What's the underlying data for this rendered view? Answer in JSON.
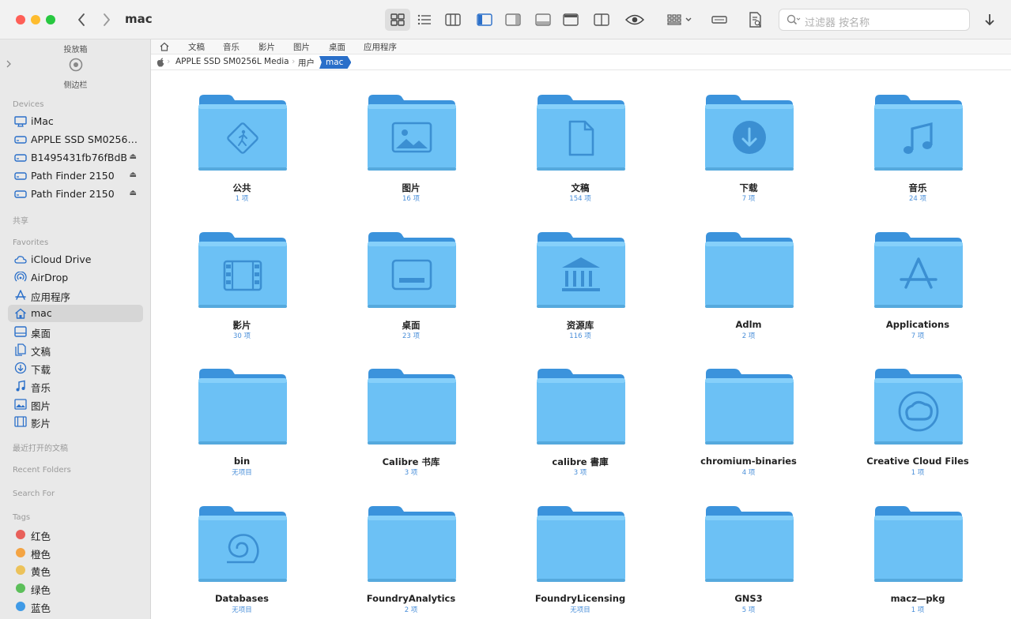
{
  "window": {
    "title": "mac"
  },
  "search": {
    "placeholder": "过滤器 按名称"
  },
  "sidebar": {
    "dropbox_label": "投放箱",
    "sidebar_label": "侧边栏",
    "devices_header": "Devices",
    "devices": [
      {
        "label": "iMac",
        "icon": "imac-icon"
      },
      {
        "label": "APPLE SSD SM0256L...",
        "icon": "disk-icon"
      },
      {
        "label": "B1495431fb76fBdB",
        "icon": "disk-icon"
      },
      {
        "label": "Path Finder 2150",
        "icon": "disk-icon"
      },
      {
        "label": "Path Finder 2150",
        "icon": "disk-icon"
      }
    ],
    "eject_symbol": "⏏",
    "shared_header": "共享",
    "favorites_header": "Favorites",
    "favorites": [
      {
        "label": "iCloud Drive",
        "icon": "cloud-icon"
      },
      {
        "label": "AirDrop",
        "icon": "airdrop-icon"
      },
      {
        "label": "应用程序",
        "icon": "applications-icon"
      },
      {
        "label": "mac",
        "icon": "home-icon",
        "selected": true
      },
      {
        "label": "桌面",
        "icon": "desktop-icon"
      },
      {
        "label": "文稿",
        "icon": "document-icon"
      },
      {
        "label": "下载",
        "icon": "download-icon"
      },
      {
        "label": "音乐",
        "icon": "music-icon"
      },
      {
        "label": "图片",
        "icon": "picture-icon"
      },
      {
        "label": "影片",
        "icon": "movie-icon"
      }
    ],
    "recent_docs_header": "最近打开的文稿",
    "recent_folders_header": "Recent Folders",
    "search_for_header": "Search For",
    "tags_header": "Tags",
    "tags": [
      {
        "label": "红色",
        "color": "#e8605a"
      },
      {
        "label": "橙色",
        "color": "#f4a443"
      },
      {
        "label": "黄色",
        "color": "#ecc25a"
      },
      {
        "label": "绿色",
        "color": "#5cbf5a"
      },
      {
        "label": "蓝色",
        "color": "#3f9ae6"
      }
    ]
  },
  "favbar": [
    "文稿",
    "音乐",
    "影片",
    "图片",
    "桌面",
    "应用程序"
  ],
  "pathbar": {
    "disk": "APPLE SSD SM0256L Media",
    "users": "用户",
    "current": "mac"
  },
  "files": [
    {
      "name": "公共",
      "count": "1 项",
      "glyph": "public"
    },
    {
      "name": "图片",
      "count": "16 项",
      "glyph": "picture"
    },
    {
      "name": "文稿",
      "count": "154 项",
      "glyph": "document"
    },
    {
      "name": "下载",
      "count": "7 项",
      "glyph": "download"
    },
    {
      "name": "音乐",
      "count": "24 项",
      "glyph": "music"
    },
    {
      "name": "影片",
      "count": "30 项",
      "glyph": "movie"
    },
    {
      "name": "桌面",
      "count": "23 项",
      "glyph": "desktop"
    },
    {
      "name": "资源库",
      "count": "116 项",
      "glyph": "library"
    },
    {
      "name": "Adlm",
      "count": "2 项",
      "glyph": ""
    },
    {
      "name": "Applications",
      "count": "7 项",
      "glyph": "applications"
    },
    {
      "name": "bin",
      "count": "无项目",
      "glyph": ""
    },
    {
      "name": "Calibre 书库",
      "count": "3 项",
      "glyph": ""
    },
    {
      "name": "calibre 書庫",
      "count": "3 项",
      "glyph": ""
    },
    {
      "name": "chromium-binaries",
      "count": "4 项",
      "glyph": ""
    },
    {
      "name": "Creative Cloud Files",
      "count": "1 项",
      "glyph": "creative-cloud"
    },
    {
      "name": "Databases",
      "count": "无项目",
      "glyph": "shell"
    },
    {
      "name": "FoundryAnalytics",
      "count": "2 项",
      "glyph": ""
    },
    {
      "name": "FoundryLicensing",
      "count": "无项目",
      "glyph": ""
    },
    {
      "name": "GNS3",
      "count": "5 项",
      "glyph": ""
    },
    {
      "name": "macz—pkg",
      "count": "1 项",
      "glyph": ""
    }
  ]
}
